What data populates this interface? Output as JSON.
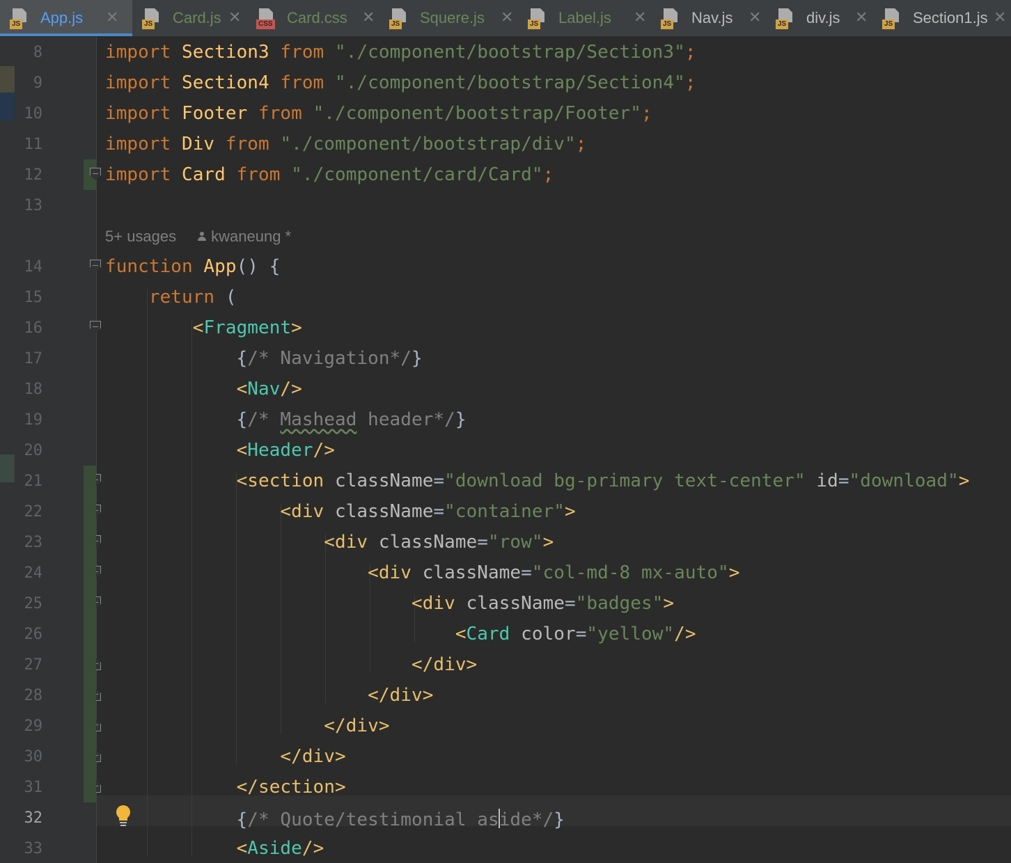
{
  "tabs": [
    {
      "name": "App.js",
      "type": "JS",
      "active": true
    },
    {
      "name": "Card.js",
      "type": "JS",
      "active": false
    },
    {
      "name": "Card.css",
      "type": "CSS",
      "active": false
    },
    {
      "name": "Squere.js",
      "type": "JS",
      "active": false
    },
    {
      "name": "Label.js",
      "type": "JS",
      "active": false
    },
    {
      "name": "Nav.js",
      "type": "JS",
      "active": false
    },
    {
      "name": "div.js",
      "type": "JS",
      "active": false
    },
    {
      "name": "Section1.js",
      "type": "JS",
      "active": false
    }
  ],
  "tab_close_glyph": "✕",
  "icons": {
    "file": "file-icon",
    "close": "close-icon",
    "user": "user-icon",
    "bulb": "lightbulb-icon"
  },
  "colors": {
    "keyword": "#cc7832",
    "identifier": "#ffc66d",
    "string": "#6a8759",
    "tag": "#e8bf6a",
    "component": "#4ec9b0",
    "comment": "#808080",
    "text": "#a9b7c6",
    "active_tab_underline": "#4a88c7",
    "bulb": "#f0b73b"
  },
  "inlay_hint": {
    "usages": "5+ usages",
    "author": "kwaneung *"
  },
  "code_lines": [
    {
      "num": "8",
      "tokens": [
        [
          "kw",
          "import "
        ],
        [
          "id",
          "Section3 "
        ],
        [
          "kw",
          "from "
        ],
        [
          "str",
          "\"./component/bootstrap/Section3\""
        ],
        [
          "kw",
          ";"
        ]
      ]
    },
    {
      "num": "9",
      "tokens": [
        [
          "kw",
          "import "
        ],
        [
          "id",
          "Section4 "
        ],
        [
          "kw",
          "from "
        ],
        [
          "str",
          "\"./component/bootstrap/Section4\""
        ],
        [
          "kw",
          ";"
        ]
      ]
    },
    {
      "num": "10",
      "tokens": [
        [
          "kw",
          "import "
        ],
        [
          "id",
          "Footer "
        ],
        [
          "kw",
          "from "
        ],
        [
          "str",
          "\"./component/bootstrap/Footer\""
        ],
        [
          "kw",
          ";"
        ]
      ]
    },
    {
      "num": "11",
      "tokens": [
        [
          "kw",
          "import "
        ],
        [
          "id",
          "Div "
        ],
        [
          "kw",
          "from "
        ],
        [
          "str",
          "\"./component/bootstrap/div\""
        ],
        [
          "kw",
          ";"
        ]
      ]
    },
    {
      "num": "12",
      "tokens": [
        [
          "kw",
          "import "
        ],
        [
          "id",
          "Card "
        ],
        [
          "kw",
          "from "
        ],
        [
          "str",
          "\"./component/card/Card\""
        ],
        [
          "kw",
          ";"
        ]
      ]
    },
    {
      "num": "13",
      "tokens": []
    },
    {
      "num": "14",
      "tokens": [
        [
          "kw",
          "function "
        ],
        [
          "id",
          "App"
        ],
        [
          "txt",
          "() {"
        ]
      ]
    },
    {
      "num": "15",
      "tokens": [
        [
          "txt",
          "    "
        ],
        [
          "kw",
          "return "
        ],
        [
          "txt",
          "("
        ]
      ]
    },
    {
      "num": "16",
      "tokens": [
        [
          "txt",
          "        "
        ],
        [
          "tag",
          "<"
        ],
        [
          "comp",
          "Fragment"
        ],
        [
          "tag",
          ">"
        ]
      ]
    },
    {
      "num": "17",
      "tokens": [
        [
          "txt",
          "            {"
        ],
        [
          "cmt",
          "/* Navigation*/"
        ],
        [
          "txt",
          "}"
        ]
      ]
    },
    {
      "num": "18",
      "tokens": [
        [
          "txt",
          "            "
        ],
        [
          "tag",
          "<"
        ],
        [
          "comp",
          "Nav"
        ],
        [
          "tag",
          "/>"
        ]
      ]
    },
    {
      "num": "19",
      "tokens": [
        [
          "txt",
          "            {"
        ],
        [
          "cmt",
          "/* "
        ],
        [
          "cmt-typo",
          "Mashead"
        ],
        [
          "cmt",
          " header*/"
        ],
        [
          "txt",
          "}"
        ]
      ]
    },
    {
      "num": "20",
      "tokens": [
        [
          "txt",
          "            "
        ],
        [
          "tag",
          "<"
        ],
        [
          "comp",
          "Header"
        ],
        [
          "tag",
          "/>"
        ]
      ]
    },
    {
      "num": "21",
      "tokens": [
        [
          "txt",
          "            "
        ],
        [
          "tag",
          "<section "
        ],
        [
          "attr",
          "className"
        ],
        [
          "txt",
          "="
        ],
        [
          "str",
          "\"download bg-primary text-center\" "
        ],
        [
          "attr",
          "id"
        ],
        [
          "txt",
          "="
        ],
        [
          "str",
          "\"download\""
        ],
        [
          "tag",
          ">"
        ]
      ]
    },
    {
      "num": "22",
      "tokens": [
        [
          "txt",
          "                "
        ],
        [
          "tag",
          "<div "
        ],
        [
          "attr",
          "className"
        ],
        [
          "txt",
          "="
        ],
        [
          "str",
          "\"container\""
        ],
        [
          "tag",
          ">"
        ]
      ]
    },
    {
      "num": "23",
      "tokens": [
        [
          "txt",
          "                    "
        ],
        [
          "tag",
          "<div "
        ],
        [
          "attr",
          "className"
        ],
        [
          "txt",
          "="
        ],
        [
          "str",
          "\"row\""
        ],
        [
          "tag",
          ">"
        ]
      ]
    },
    {
      "num": "24",
      "tokens": [
        [
          "txt",
          "                        "
        ],
        [
          "tag",
          "<div "
        ],
        [
          "attr",
          "className"
        ],
        [
          "txt",
          "="
        ],
        [
          "str",
          "\"col-md-8 mx-auto\""
        ],
        [
          "tag",
          ">"
        ]
      ]
    },
    {
      "num": "25",
      "tokens": [
        [
          "txt",
          "                            "
        ],
        [
          "tag",
          "<div "
        ],
        [
          "attr",
          "className"
        ],
        [
          "txt",
          "="
        ],
        [
          "str",
          "\"badges\""
        ],
        [
          "tag",
          ">"
        ]
      ]
    },
    {
      "num": "26",
      "tokens": [
        [
          "txt",
          "                                "
        ],
        [
          "tag",
          "<"
        ],
        [
          "comp",
          "Card "
        ],
        [
          "attr",
          "color"
        ],
        [
          "txt",
          "="
        ],
        [
          "str",
          "\"yellow\""
        ],
        [
          "tag",
          "/>"
        ]
      ]
    },
    {
      "num": "27",
      "tokens": [
        [
          "txt",
          "                            "
        ],
        [
          "tag",
          "</div>"
        ]
      ]
    },
    {
      "num": "28",
      "tokens": [
        [
          "txt",
          "                        "
        ],
        [
          "tag",
          "</div>"
        ]
      ]
    },
    {
      "num": "29",
      "tokens": [
        [
          "txt",
          "                    "
        ],
        [
          "tag",
          "</div>"
        ]
      ]
    },
    {
      "num": "30",
      "tokens": [
        [
          "txt",
          "                "
        ],
        [
          "tag",
          "</div>"
        ]
      ]
    },
    {
      "num": "31",
      "tokens": [
        [
          "txt",
          "            "
        ],
        [
          "tag",
          "</section>"
        ]
      ]
    },
    {
      "num": "32",
      "tokens": [
        [
          "txt",
          "            {"
        ],
        [
          "cmt",
          "/* Quote/testimonial as"
        ],
        [
          "caret",
          ""
        ],
        [
          "cmt",
          "ide*/"
        ],
        [
          "txt",
          "}"
        ]
      ]
    },
    {
      "num": "33",
      "tokens": [
        [
          "txt",
          "            "
        ],
        [
          "tag",
          "<"
        ],
        [
          "comp",
          "Aside"
        ],
        [
          "tag",
          "/>"
        ]
      ]
    }
  ]
}
